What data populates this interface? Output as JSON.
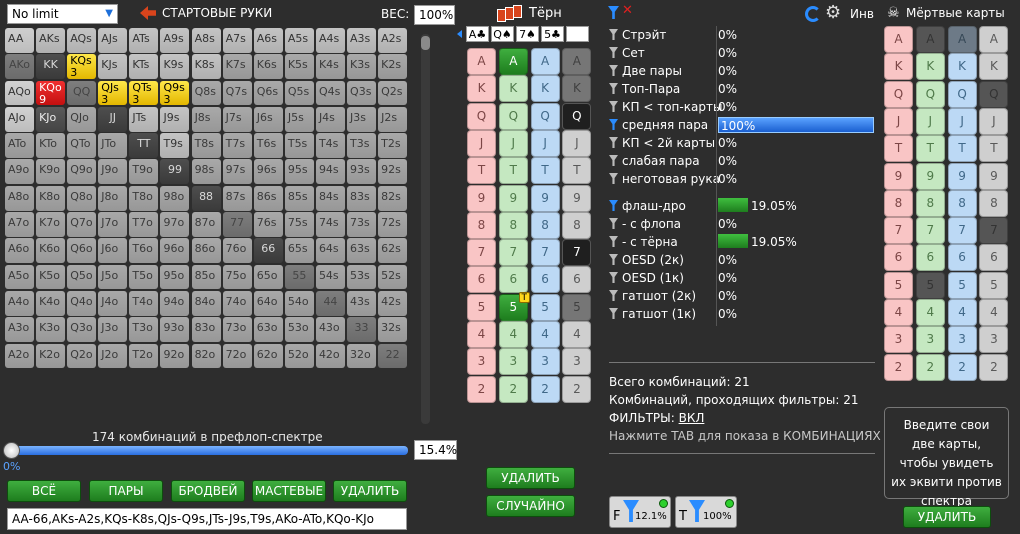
{
  "top": {
    "game_select": "No limit",
    "starting_hands_label": "СТАРТОВЫЕ РУКИ",
    "weight_label": "ВЕС:",
    "weight_value": "100%",
    "turn_label": "Тёрн",
    "inv_label": "Инв",
    "dead_cards_label": "Мёртвые карты"
  },
  "hand_matrix": {
    "rows": [
      [
        "AA",
        "AKs",
        "AQs",
        "AJs",
        "ATs",
        "A9s",
        "A8s",
        "A7s",
        "A6s",
        "A5s",
        "A4s",
        "A3s",
        "A2s"
      ],
      [
        "AKo",
        "KK",
        "KQs",
        "KJs",
        "KTs",
        "K9s",
        "K8s",
        "K7s",
        "K6s",
        "K5s",
        "K4s",
        "K3s",
        "K2s"
      ],
      [
        "AQo",
        "KQo",
        "QQ",
        "QJs",
        "QTs",
        "Q9s",
        "Q8s",
        "Q7s",
        "Q6s",
        "Q5s",
        "Q4s",
        "Q3s",
        "Q2s"
      ],
      [
        "AJo",
        "KJo",
        "QJo",
        "JJ",
        "JTs",
        "J9s",
        "J8s",
        "J7s",
        "J6s",
        "J5s",
        "J4s",
        "J3s",
        "J2s"
      ],
      [
        "ATo",
        "KTo",
        "QTo",
        "JTo",
        "TT",
        "T9s",
        "T8s",
        "T7s",
        "T6s",
        "T5s",
        "T4s",
        "T3s",
        "T2s"
      ],
      [
        "A9o",
        "K9o",
        "Q9o",
        "J9o",
        "T9o",
        "99",
        "98s",
        "97s",
        "96s",
        "95s",
        "94s",
        "93s",
        "92s"
      ],
      [
        "A8o",
        "K8o",
        "Q8o",
        "J8o",
        "T8o",
        "98o",
        "88",
        "87s",
        "86s",
        "85s",
        "84s",
        "83s",
        "82s"
      ],
      [
        "A7o",
        "K7o",
        "Q7o",
        "J7o",
        "T7o",
        "97o",
        "87o",
        "77",
        "76s",
        "75s",
        "74s",
        "73s",
        "72s"
      ],
      [
        "A6o",
        "K6o",
        "Q6o",
        "J6o",
        "T6o",
        "96o",
        "86o",
        "76o",
        "66",
        "65s",
        "64s",
        "63s",
        "62s"
      ],
      [
        "A5o",
        "K5o",
        "Q5o",
        "J5o",
        "T5o",
        "95o",
        "85o",
        "75o",
        "65o",
        "55",
        "54s",
        "53s",
        "52s"
      ],
      [
        "A4o",
        "K4o",
        "Q4o",
        "J4o",
        "T4o",
        "94o",
        "84o",
        "74o",
        "64o",
        "54o",
        "44",
        "43s",
        "42s"
      ],
      [
        "A3o",
        "K3o",
        "Q3o",
        "J3o",
        "T3o",
        "93o",
        "83o",
        "73o",
        "63o",
        "53o",
        "43o",
        "33",
        "32s"
      ],
      [
        "A2o",
        "K2o",
        "Q2o",
        "J2o",
        "T2o",
        "92o",
        "82o",
        "72o",
        "62o",
        "52o",
        "42o",
        "32o",
        "22"
      ]
    ],
    "styles": {
      "0,0": "pa",
      "0,1": "p",
      "0,2": "p",
      "0,3": "p",
      "0,4": "p",
      "0,5": "p",
      "0,6": "p",
      "0,7": "p",
      "0,8": "p",
      "0,9": "p",
      "0,10": "p",
      "0,11": "p",
      "0,12": "p",
      "1,0": "md",
      "1,1": "dk",
      "1,2": "y",
      "1,3": "p",
      "1,4": "p",
      "1,5": "p",
      "1,6": "p",
      "2,0": "ko",
      "2,1": "r",
      "2,2": "md",
      "2,3": "y",
      "2,4": "y",
      "2,5": "y",
      "3,0": "ko",
      "3,1": "dsel",
      "3,3": "dk",
      "3,4": "p",
      "3,5": "p",
      "4,4": "dk",
      "4,5": "p",
      "5,5": "dk",
      "6,6": "dk",
      "7,7": "md",
      "8,8": "dk",
      "9,9": "md",
      "10,10": "md",
      "11,11": "md",
      "12,12": "md"
    },
    "counts": {
      "1,2": "3",
      "2,1": "9",
      "2,3": "3",
      "2,4": "3",
      "2,5": "3"
    },
    "combos_label": "174 комбинаций в префлоп-спектре",
    "slider_pct": "15.4%",
    "slider_zero": "0%"
  },
  "board": [
    "A♣",
    "Q♠",
    "7♠",
    "5♣",
    ""
  ],
  "turn_cards": {
    "ranks": [
      "A",
      "K",
      "Q",
      "J",
      "T",
      "9",
      "8",
      "7",
      "6",
      "5",
      "4",
      "3",
      "2"
    ],
    "suits": [
      "h",
      "c",
      "d",
      "s"
    ],
    "states": {
      "A,c": "gsel",
      "A,s": "dis",
      "K,s": "dis",
      "Q,s": "blk",
      "7,s": "blk",
      "5,c": "gsel-t",
      "5,s": "dis"
    },
    "turn_marker": "T"
  },
  "stats": {
    "rows": [
      {
        "label": "Стрэйт",
        "value": "0%",
        "pct": 0
      },
      {
        "label": "Сет",
        "value": "0%",
        "pct": 0
      },
      {
        "label": "Две пары",
        "value": "0%",
        "pct": 0
      },
      {
        "label": "Топ-Пара",
        "value": "0%",
        "pct": 0
      },
      {
        "label": "КП < топ-карты",
        "value": "0%",
        "pct": 0
      },
      {
        "label": "средняя пара",
        "value": "100%",
        "pct": 1,
        "active": true
      },
      {
        "label": "КП < 2й карты",
        "value": "0%",
        "pct": 0
      },
      {
        "label": "слабая пара",
        "value": "0%",
        "pct": 0
      },
      {
        "label": "неготовая рука",
        "value": "0%",
        "pct": 0
      }
    ],
    "draws": [
      {
        "label": "флаш-дро",
        "value": "19.05%",
        "pct": 0.1905,
        "active": true
      },
      {
        "label": "- с флопа",
        "value": "0%",
        "pct": 0
      },
      {
        "label": "- с тёрна",
        "value": "19.05%",
        "pct": 0.1905
      },
      {
        "label": "OESD (2к)",
        "value": "0%",
        "pct": 0
      },
      {
        "label": "OESD (1к)",
        "value": "0%",
        "pct": 0
      },
      {
        "label": "гатшот (2к)",
        "value": "0%",
        "pct": 0
      },
      {
        "label": "гатшот (1к)",
        "value": "0%",
        "pct": 0
      }
    ],
    "total_combos": "Всего комбинаций: 21",
    "passing_combos": "Комбинаций, проходящих фильтры: 21",
    "filters_label": "ФИЛЬТРЫ:",
    "filters_value": "ВКЛ",
    "tab_hint": "Нажмите TAB для показа в КОМБИНАЦИЯХ"
  },
  "filter_buttons": {
    "f_label": "F",
    "f_value": "12.1%",
    "t_label": "T",
    "t_value": "100%"
  },
  "dead_cards": {
    "ranks": [
      "A",
      "K",
      "Q",
      "J",
      "T",
      "9",
      "8",
      "7",
      "6",
      "5",
      "4",
      "3",
      "2"
    ],
    "suits": [
      "h",
      "c",
      "d",
      "s"
    ],
    "states": {
      "A,c": "gray",
      "A,d": "dis",
      "Q,s": "gray",
      "7,s": "gray",
      "5,c": "gray"
    },
    "hint": "Введите свои две карты, чтобы увидеть их эквити против спектра",
    "delete_button": "УДАЛИТЬ"
  },
  "buttons": {
    "all": "ВСЁ",
    "pairs": "ПАРЫ",
    "broadway": "БРОДВЕЙ",
    "suited": "МАСТЕВЫЕ",
    "delete": "УДАЛИТЬ",
    "turn_delete": "УДАЛИТЬ",
    "random": "СЛУЧАЙНО"
  },
  "range_text": "AA-66,AKs-A2s,KQs-K8s,QJs-Q9s,JTs-J9s,T9s,AKo-ATo,KQo-KJo",
  "colors": {
    "green": "#1e7d1e",
    "blue": "#2a8cff",
    "yellow": "#ffd81a",
    "red": "#e02020"
  }
}
